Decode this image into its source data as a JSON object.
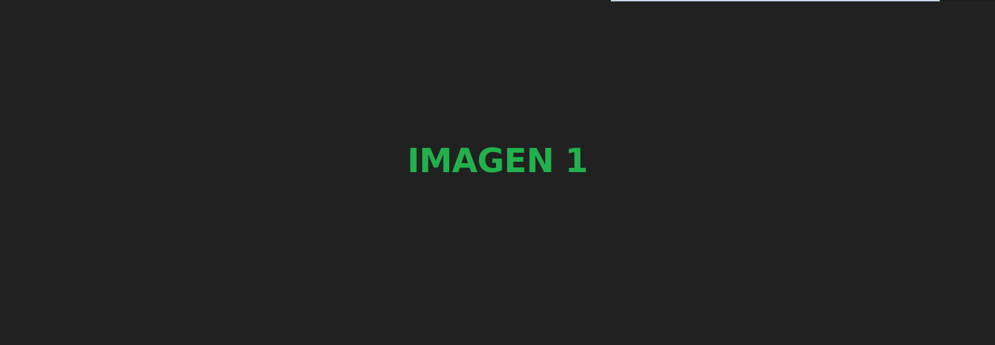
{
  "placeholder": {
    "title": "IMAGEN 1"
  },
  "colors": {
    "background": "#212121",
    "accent": "#22b14c",
    "top_strip": "#c9d3e8"
  }
}
